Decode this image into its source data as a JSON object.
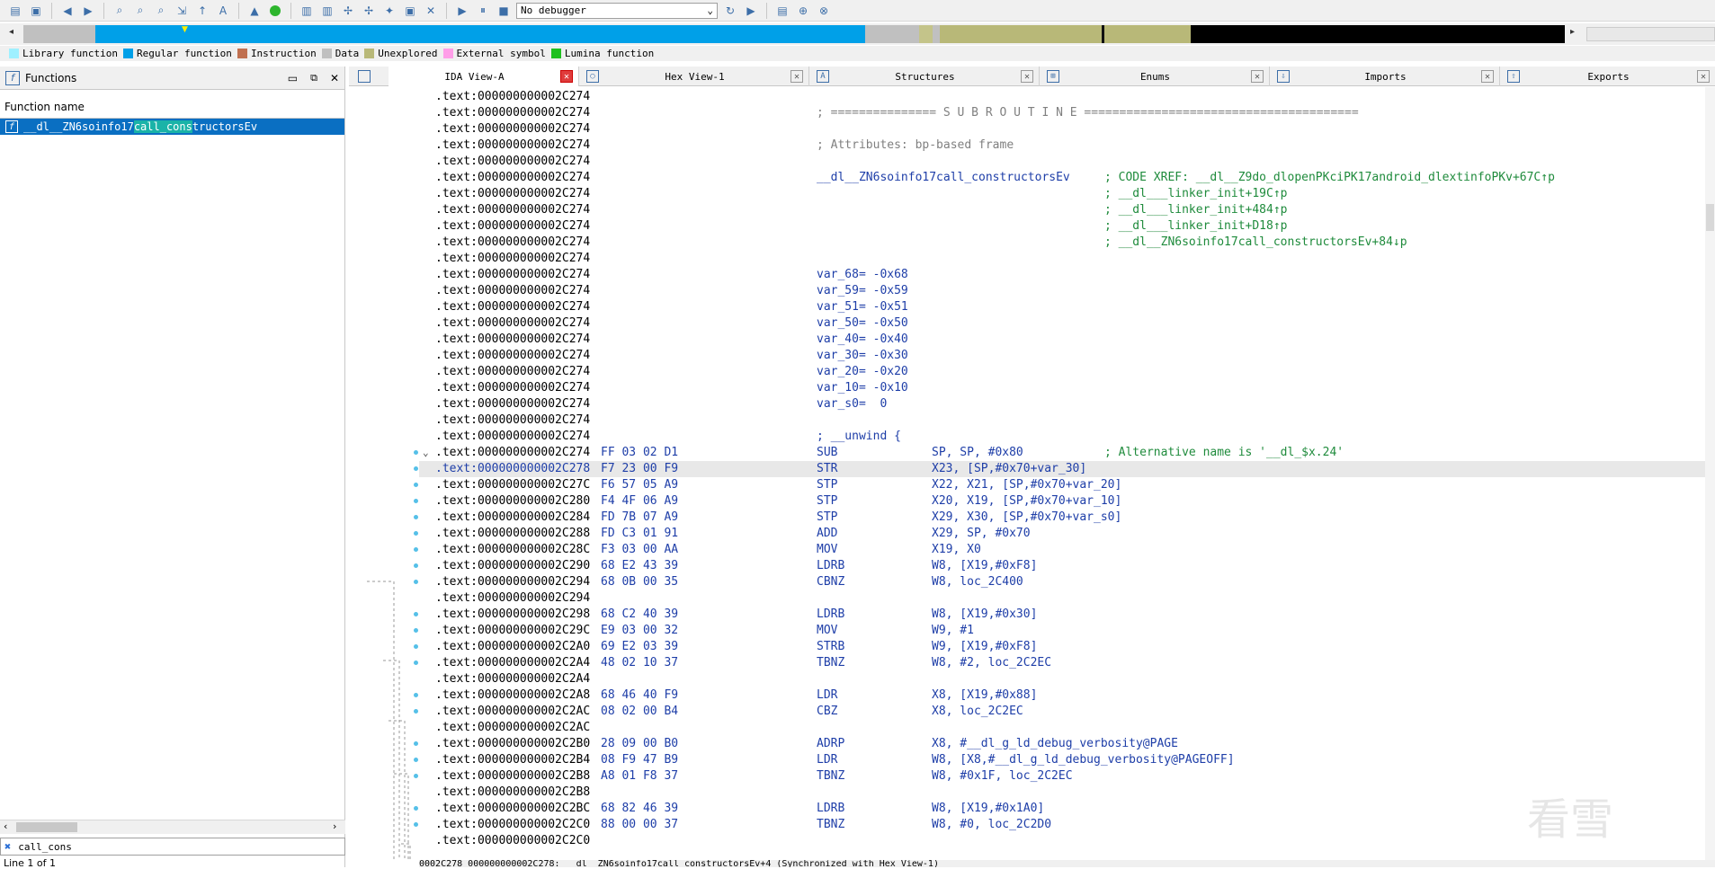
{
  "toolbar": {
    "debugger_select": "No debugger",
    "icons": [
      "open-icon",
      "save-icon",
      "back-icon",
      "forward-icon",
      "search-icon",
      "refresh-icon",
      "play-icon",
      "pause-icon",
      "stop-icon"
    ]
  },
  "legend": [
    {
      "label": "Library function",
      "color": "#9ff0ff"
    },
    {
      "label": "Regular function",
      "color": "#00a0e8"
    },
    {
      "label": "Instruction",
      "color": "#c07050"
    },
    {
      "label": "Data",
      "color": "#c0c0c0"
    },
    {
      "label": "Unexplored",
      "color": "#b8b878"
    },
    {
      "label": "External symbol",
      "color": "#ff9ee8"
    },
    {
      "label": "Lumina function",
      "color": "#20c020"
    }
  ],
  "functions_panel": {
    "title": "Functions",
    "column_header": "Function name",
    "selected_function": {
      "pre": "__dl__ZN6soinfo17",
      "match": "call_cons",
      "post": "tructorsEv"
    },
    "filter_text": "call_cons",
    "status": "Line 1 of 1"
  },
  "tabs": [
    {
      "label": "IDA View-A",
      "icon": "A",
      "active": true
    },
    {
      "label": "Hex View-1",
      "icon": "O",
      "active": false
    },
    {
      "label": "Structures",
      "icon": "A",
      "active": false
    },
    {
      "label": "Enums",
      "icon": "E",
      "active": false
    },
    {
      "label": "Imports",
      "icon": "I",
      "active": false
    },
    {
      "label": "Exports",
      "icon": "E",
      "active": false
    }
  ],
  "code": {
    "header_lines": [
      {
        "addr": ".text:000000000002C274",
        "kind": "blank"
      },
      {
        "addr": ".text:000000000002C274",
        "kind": "comment",
        "text": "; =============== S U B R O U T I N E ======================================="
      },
      {
        "addr": ".text:000000000002C274",
        "kind": "blank"
      },
      {
        "addr": ".text:000000000002C274",
        "kind": "comment",
        "text": "; Attributes: bp-based frame"
      },
      {
        "addr": ".text:000000000002C274",
        "kind": "blank"
      },
      {
        "addr": ".text:000000000002C274",
        "kind": "label",
        "text": "__dl__ZN6soinfo17call_constructorsEv",
        "xref": "; CODE XREF: __dl__Z9do_dlopenPKciPK17android_dlextinfoPKv+67C↑p"
      },
      {
        "addr": ".text:000000000002C274",
        "kind": "xref",
        "xref": "; __dl___linker_init+19C↑p"
      },
      {
        "addr": ".text:000000000002C274",
        "kind": "xref",
        "xref": "; __dl___linker_init+484↑p"
      },
      {
        "addr": ".text:000000000002C274",
        "kind": "xref",
        "xref": "; __dl___linker_init+D18↑p"
      },
      {
        "addr": ".text:000000000002C274",
        "kind": "xref",
        "xref": "; __dl__ZN6soinfo17call_constructorsEv+84↓p"
      },
      {
        "addr": ".text:000000000002C274",
        "kind": "blank"
      },
      {
        "addr": ".text:000000000002C274",
        "kind": "label",
        "text": "var_68= -0x68"
      },
      {
        "addr": ".text:000000000002C274",
        "kind": "label",
        "text": "var_59= -0x59"
      },
      {
        "addr": ".text:000000000002C274",
        "kind": "label",
        "text": "var_51= -0x51"
      },
      {
        "addr": ".text:000000000002C274",
        "kind": "label",
        "text": "var_50= -0x50"
      },
      {
        "addr": ".text:000000000002C274",
        "kind": "label",
        "text": "var_40= -0x40"
      },
      {
        "addr": ".text:000000000002C274",
        "kind": "label",
        "text": "var_30= -0x30"
      },
      {
        "addr": ".text:000000000002C274",
        "kind": "label",
        "text": "var_20= -0x20"
      },
      {
        "addr": ".text:000000000002C274",
        "kind": "label",
        "text": "var_10= -0x10"
      },
      {
        "addr": ".text:000000000002C274",
        "kind": "label",
        "text": "var_s0=  0"
      },
      {
        "addr": ".text:000000000002C274",
        "kind": "blank"
      },
      {
        "addr": ".text:000000000002C274",
        "kind": "label",
        "text": "; __unwind {"
      }
    ],
    "instructions": [
      {
        "addr": ".text:000000000002C274",
        "bytes": "FF 03 02 D1",
        "mn": "SUB",
        "op": "SP, SP, #0x80",
        "cm": "; Alternative name is '__dl_$x.24'",
        "chev": true
      },
      {
        "addr": ".text:000000000002C278",
        "bytes": "F7 23 00 F9",
        "mn": "STR",
        "op": "X23, [SP,#0x70+var_30]",
        "sel": true
      },
      {
        "addr": ".text:000000000002C27C",
        "bytes": "F6 57 05 A9",
        "mn": "STP",
        "op": "X22, X21, [SP,#0x70+var_20]"
      },
      {
        "addr": ".text:000000000002C280",
        "bytes": "F4 4F 06 A9",
        "mn": "STP",
        "op": "X20, X19, [SP,#0x70+var_10]"
      },
      {
        "addr": ".text:000000000002C284",
        "bytes": "FD 7B 07 A9",
        "mn": "STP",
        "op": "X29, X30, [SP,#0x70+var_s0]"
      },
      {
        "addr": ".text:000000000002C288",
        "bytes": "FD C3 01 91",
        "mn": "ADD",
        "op": "X29, SP, #0x70"
      },
      {
        "addr": ".text:000000000002C28C",
        "bytes": "F3 03 00 AA",
        "mn": "MOV",
        "op": "X19, X0"
      },
      {
        "addr": ".text:000000000002C290",
        "bytes": "68 E2 43 39",
        "mn": "LDRB",
        "op": "W8, [X19,#0xF8]"
      },
      {
        "addr": ".text:000000000002C294",
        "bytes": "68 0B 00 35",
        "mn": "CBNZ",
        "op": "W8, loc_2C400"
      },
      {
        "addr": ".text:000000000002C294",
        "bytes": "",
        "mn": "",
        "op": ""
      },
      {
        "addr": ".text:000000000002C298",
        "bytes": "68 C2 40 39",
        "mn": "LDRB",
        "op": "W8, [X19,#0x30]"
      },
      {
        "addr": ".text:000000000002C29C",
        "bytes": "E9 03 00 32",
        "mn": "MOV",
        "op": "W9, #1"
      },
      {
        "addr": ".text:000000000002C2A0",
        "bytes": "69 E2 03 39",
        "mn": "STRB",
        "op": "W9, [X19,#0xF8]"
      },
      {
        "addr": ".text:000000000002C2A4",
        "bytes": "48 02 10 37",
        "mn": "TBNZ",
        "op": "W8, #2, loc_2C2EC"
      },
      {
        "addr": ".text:000000000002C2A4",
        "bytes": "",
        "mn": "",
        "op": ""
      },
      {
        "addr": ".text:000000000002C2A8",
        "bytes": "68 46 40 F9",
        "mn": "LDR",
        "op": "X8, [X19,#0x88]"
      },
      {
        "addr": ".text:000000000002C2AC",
        "bytes": "08 02 00 B4",
        "mn": "CBZ",
        "op": "X8, loc_2C2EC"
      },
      {
        "addr": ".text:000000000002C2AC",
        "bytes": "",
        "mn": "",
        "op": ""
      },
      {
        "addr": ".text:000000000002C2B0",
        "bytes": "28 09 00 B0",
        "mn": "ADRP",
        "op": "X8, #__dl_g_ld_debug_verbosity@PAGE"
      },
      {
        "addr": ".text:000000000002C2B4",
        "bytes": "08 F9 47 B9",
        "mn": "LDR",
        "op": "W8, [X8,#__dl_g_ld_debug_verbosity@PAGEOFF]"
      },
      {
        "addr": ".text:000000000002C2B8",
        "bytes": "A8 01 F8 37",
        "mn": "TBNZ",
        "op": "W8, #0x1F, loc_2C2EC"
      },
      {
        "addr": ".text:000000000002C2B8",
        "bytes": "",
        "mn": "",
        "op": ""
      },
      {
        "addr": ".text:000000000002C2BC",
        "bytes": "68 82 46 39",
        "mn": "LDRB",
        "op": "W8, [X19,#0x1A0]"
      },
      {
        "addr": ".text:000000000002C2C0",
        "bytes": "88 00 00 37",
        "mn": "TBNZ",
        "op": "W8, #0, loc_2C2D0"
      },
      {
        "addr": ".text:000000000002C2C0",
        "bytes": "",
        "mn": "",
        "op": ""
      }
    ]
  },
  "status_line": "0002C278 000000000002C278: __dl__ZN6soinfo17call_constructorsEv+4 (Synchronized with Hex View-1)",
  "watermark": "看雪"
}
